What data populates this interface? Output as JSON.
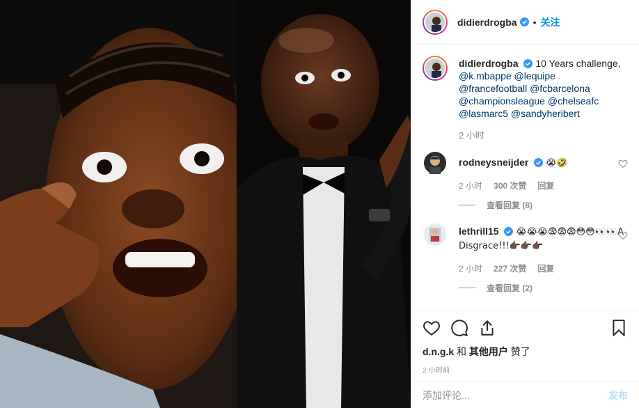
{
  "post": {
    "username": "didierdrogba",
    "follow_label": "关注",
    "dot": "•"
  },
  "caption": {
    "username": "didierdrogba",
    "text": "10 Years challenge,",
    "mentions": [
      "@k.mbappe",
      "@lequipe",
      "@francefootball",
      "@fcbarcelona",
      "@championsleague",
      "@chelseafc",
      "@lasmarc5",
      "@sandyheribert"
    ],
    "time": "2 小时"
  },
  "comments": [
    {
      "username": "rodneysneijder",
      "text": "😭🤣",
      "time": "2 小时",
      "likes": "300 次赞",
      "reply_label": "回复",
      "view_replies": "查看回复 (8)"
    },
    {
      "username": "lethrill15",
      "text": "😭😭😭😨😨😨😳😳👀👀A Disgrace!!!👉🏿👉🏿👉🏿",
      "time": "2 小时",
      "likes": "227 次赞",
      "reply_label": "回复",
      "view_replies": "查看回复 (2)"
    }
  ],
  "actions": {
    "icons": [
      "heart-icon",
      "comment-icon",
      "share-icon",
      "bookmark-icon"
    ]
  },
  "likes": {
    "first_user": "d.n.g.k",
    "connector": "和",
    "others": "其他用户",
    "suffix": "赞了"
  },
  "posted_time": "2 小时前",
  "add_comment": {
    "placeholder": "添加评论...",
    "post_label": "发布"
  },
  "colors": {
    "accent": "#0095f6",
    "mention": "#003569",
    "muted": "#8e8e8e",
    "post_disabled": "#b2dffc"
  }
}
